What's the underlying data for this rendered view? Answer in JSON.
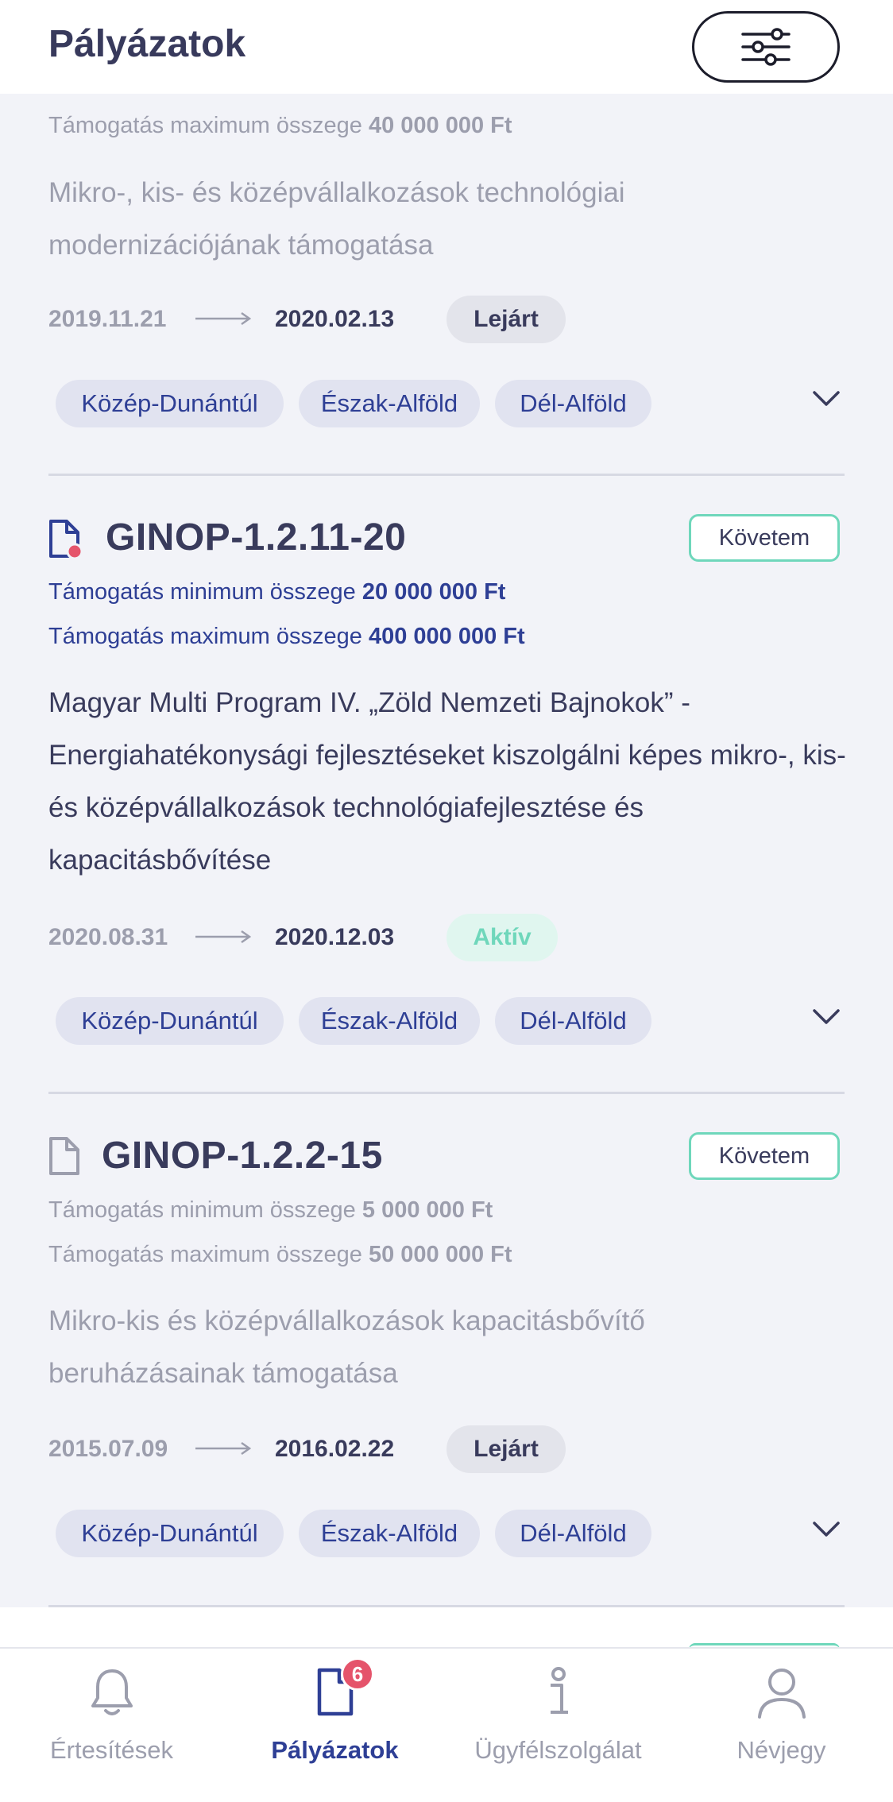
{
  "header": {
    "title": "Pályázatok"
  },
  "cards": [
    {
      "amount_max_label": "Támogatás maximum összege",
      "amount_max_value": "40 000 000 Ft",
      "description": "Mikro-, kis- és középvállalkozások technológiai modernizációjának támogatása",
      "date_from": "2019.11.21",
      "date_to": "2020.02.13",
      "status": "Lejárt",
      "tags": [
        "Közép-Dunántúl",
        "Észak-Alföld",
        "Dél-Alföld"
      ]
    },
    {
      "title": "GINOP-1.2.11-20",
      "follow_label": "Követem",
      "amount_min_label": "Támogatás minimum összege",
      "amount_min_value": "20 000 000 Ft",
      "amount_max_label": "Támogatás maximum összege",
      "amount_max_value": "400 000 000 Ft",
      "description": "Magyar Multi Program IV. „Zöld Nemzeti Bajnokok” - Energiahatékonysági fejlesztéseket kiszolgálni képes mikro-, kis- és középvállalkozások technológiafejlesztése és kapacitásbővítése",
      "date_from": "2020.08.31",
      "date_to": "2020.12.03",
      "status": "Aktív",
      "tags": [
        "Közép-Dunántúl",
        "Észak-Alföld",
        "Dél-Alföld"
      ]
    },
    {
      "title": "GINOP-1.2.2-15",
      "follow_label": "Követem",
      "amount_min_label": "Támogatás minimum összege",
      "amount_min_value": "5 000 000 Ft",
      "amount_max_label": "Támogatás maximum összege",
      "amount_max_value": "50 000 000 Ft",
      "description": "Mikro-kis és középvállalkozások kapacitásbővítő beruházásainak támogatása",
      "date_from": "2015.07.09",
      "date_to": "2016.02.22",
      "status": "Lejárt",
      "tags": [
        "Közép-Dunántúl",
        "Észak-Alföld",
        "Dél-Alföld"
      ]
    }
  ],
  "bottom_nav": {
    "items": [
      {
        "label": "Értesítések",
        "icon": "bell-icon"
      },
      {
        "label": "Pályázatok",
        "icon": "document-icon",
        "badge": "6"
      },
      {
        "label": "Ügyfélszolgálat",
        "icon": "info-icon"
      },
      {
        "label": "Névjegy",
        "icon": "person-icon"
      }
    ]
  },
  "colors": {
    "accent": "#2e3f95",
    "active_green": "#6fd7bb",
    "badge_red": "#e5546b"
  }
}
